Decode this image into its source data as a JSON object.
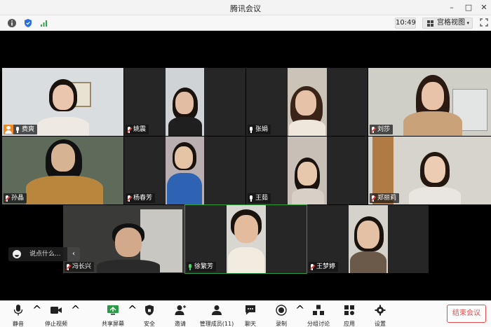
{
  "window": {
    "title": "腾讯会议",
    "minimize": "–",
    "maximize": "□",
    "close": "✕"
  },
  "status": {
    "time": "10:49",
    "view_label": "宫格视图",
    "view_caret": "▾"
  },
  "participants": [
    {
      "name": "费爽",
      "host": true,
      "mic": "on"
    },
    {
      "name": "姚震",
      "host": false,
      "mic": "muted"
    },
    {
      "name": "张娟",
      "host": false,
      "mic": "on"
    },
    {
      "name": "刘莎",
      "host": false,
      "mic": "muted"
    },
    {
      "name": "孙晶",
      "host": false,
      "mic": "muted"
    },
    {
      "name": "杨春芳",
      "host": false,
      "mic": "muted"
    },
    {
      "name": "王茹",
      "host": false,
      "mic": "on"
    },
    {
      "name": "郑丽莉",
      "host": false,
      "mic": "muted"
    },
    {
      "name": "冯长兴",
      "host": false,
      "mic": "muted"
    },
    {
      "name": "徐繁芳",
      "host": false,
      "mic": "speaking"
    },
    {
      "name": "王梦婷",
      "host": false,
      "mic": "muted"
    }
  ],
  "chat": {
    "placeholder": "说点什么...",
    "collapse": "‹"
  },
  "toolbar": {
    "mute": "静音",
    "stop_video": "停止视频",
    "share": "共享屏幕",
    "security": "安全",
    "invite": "邀请",
    "manage": "管理成员(11)",
    "chat": "聊天",
    "record": "录制",
    "breakout": "分组讨论",
    "apps": "应用",
    "settings": "设置",
    "end": "结束会议",
    "caret": "^"
  },
  "colors": {
    "accent_green": "#2f9a3c",
    "end_red": "#e24b4b",
    "host_orange": "#f08a24"
  }
}
